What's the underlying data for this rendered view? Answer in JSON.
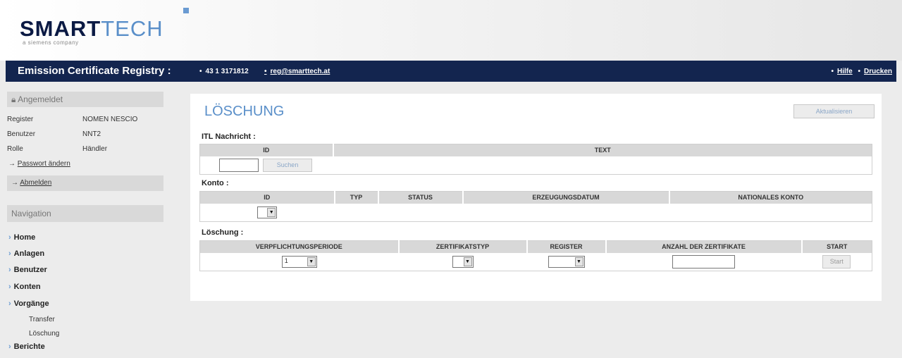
{
  "brand": {
    "logo_smart": "SMART",
    "logo_tech": "TECH",
    "tagline": "a siemens company",
    "accent_color": "#6a9bd2",
    "title_bar_color": "#13254f"
  },
  "titlebar": {
    "title": "Emission Certificate Registry :",
    "phone": "43 1 3171812",
    "email": "reg@smarttech.at",
    "help": "Hilfe",
    "print": "Drucken"
  },
  "sidebar": {
    "login_header": "Angemeldet",
    "info": [
      {
        "label": "Register",
        "value": "NOMEN NESCIO"
      },
      {
        "label": "Benutzer",
        "value": "NNT2"
      },
      {
        "label": "Rolle",
        "value": "Händler"
      }
    ],
    "change_password": "Passwort ändern",
    "logout": "Abmelden",
    "nav_header": "Navigation",
    "nav": [
      {
        "label": "Home"
      },
      {
        "label": "Anlagen"
      },
      {
        "label": "Benutzer"
      },
      {
        "label": "Konten"
      },
      {
        "label": "Vorgänge"
      },
      {
        "label": "Berichte"
      }
    ],
    "subnav": [
      "Transfer",
      "Löschung"
    ]
  },
  "main": {
    "title": "LÖSCHUNG",
    "refresh_button": "Aktualisieren",
    "itl": {
      "label": "ITL Nachricht :",
      "columns": [
        "ID",
        "TEXT"
      ],
      "search_button": "Suchen",
      "id_value": ""
    },
    "konto": {
      "label": "Konto :",
      "columns": [
        "ID",
        "TYP",
        "STATUS",
        "ERZEUGUNGSDATUM",
        "NATIONALES KONTO"
      ],
      "id_selected": ""
    },
    "loeschung": {
      "label": "Löschung :",
      "columns": [
        "VERPFLICHTUNGSPERIODE",
        "ZERTIFIKATSTYP",
        "REGISTER",
        "ANZAHL DER ZERTIFIKATE",
        "START"
      ],
      "period_selected": "1",
      "type_selected": "",
      "register_selected": "",
      "amount_value": "",
      "start_button": "Start"
    }
  }
}
